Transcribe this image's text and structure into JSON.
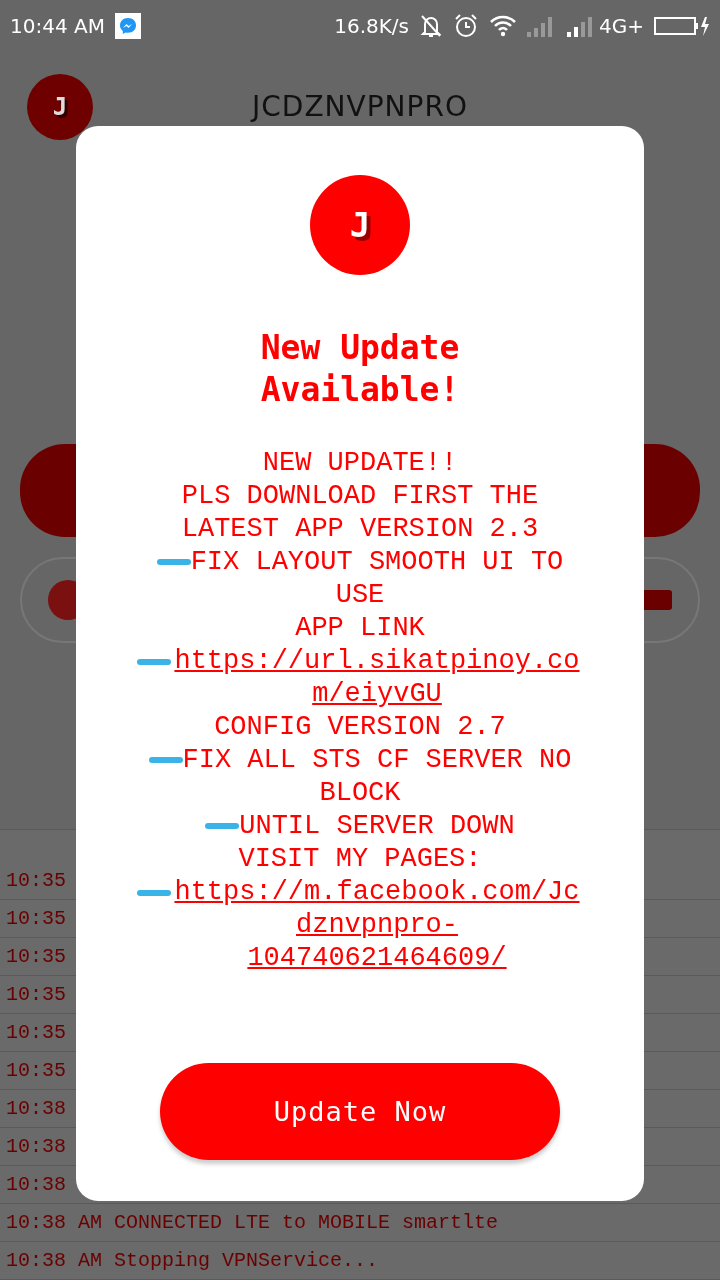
{
  "status_bar": {
    "time": "10:44 AM",
    "speed": "16.8K/s",
    "network": "4G+"
  },
  "header": {
    "logo_letter": "J",
    "title": "JCDZNVPNPRO"
  },
  "log": [
    {
      "text": "10:35"
    },
    {
      "text": "10:35"
    },
    {
      "text": "10:35"
    },
    {
      "text": "10:35"
    },
    {
      "text": "10:35"
    },
    {
      "text": "10:35"
    },
    {
      "text": "10:38"
    },
    {
      "text": "10:38"
    },
    {
      "text": "10:38"
    },
    {
      "text": "10:38 AM CONNECTED LTE to MOBILE smartlte"
    },
    {
      "text": "10:38 AM Stopping VPNService..."
    }
  ],
  "dialog": {
    "logo_letter": "J",
    "title": "New Update Available!",
    "message": [
      {
        "kind": "text",
        "bullet": false,
        "text": "NEW UPDATE!!"
      },
      {
        "kind": "text",
        "bullet": false,
        "text": "PLS DOWNLOAD FIRST THE LATEST APP VERSION  2.3"
      },
      {
        "kind": "text",
        "bullet": true,
        "text": "FIX LAYOUT SMOOTH UI TO USE"
      },
      {
        "kind": "text",
        "bullet": false,
        "text": "APP LINK"
      },
      {
        "kind": "link",
        "bullet": true,
        "text": "https://url.sikatpinoy.com/eiyvGU"
      },
      {
        "kind": "text",
        "bullet": false,
        "text": "CONFIG VERSION 2.7"
      },
      {
        "kind": "text",
        "bullet": true,
        "text": "FIX ALL STS CF SERVER NO BLOCK"
      },
      {
        "kind": "text",
        "bullet": true,
        "text": "UNTIL SERVER DOWN"
      },
      {
        "kind": "text",
        "bullet": false,
        "text": "VISIT MY PAGES:"
      },
      {
        "kind": "link",
        "bullet": true,
        "text": "https://m.facebook.com/Jcdznvpnpro-104740621464609/"
      }
    ],
    "button": "Update Now"
  }
}
